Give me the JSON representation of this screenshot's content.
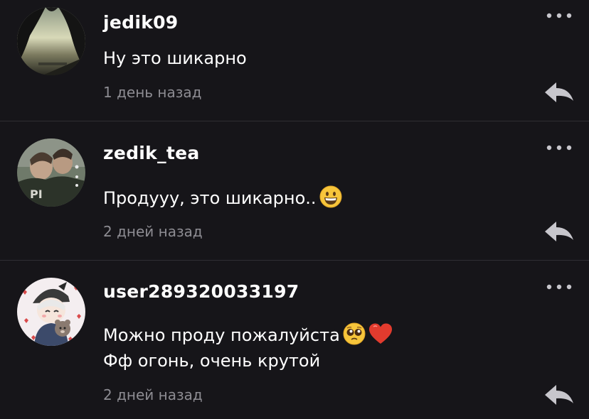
{
  "comments": [
    {
      "username": "jedik09",
      "text_lines": [
        "Ну это шикарно"
      ],
      "time": "1 день назад",
      "avatar": "photo-silhouette-sunset",
      "more_icon": "more-dots-icon",
      "reply_icon": "reply-arrow-icon"
    },
    {
      "username": "zedik_tea",
      "text_lines": [
        "Продууу, это шикарно.."
      ],
      "emojis": [
        "grinning-face-emoji"
      ],
      "time": "2 дней назад",
      "avatar": "photo-two-people",
      "more_icon": "more-dots-icon",
      "reply_icon": "reply-arrow-icon"
    },
    {
      "username": "user289320033197",
      "text_lines": [
        "Можно проду пожалуйста",
        "Фф огонь, очень крутой"
      ],
      "emojis": [
        "pleading-face-emoji",
        "red-heart-emoji"
      ],
      "time": "2 дней назад",
      "avatar": "anime-character-with-bear",
      "more_icon": "more-dots-icon",
      "reply_icon": "reply-arrow-icon"
    }
  ],
  "colors": {
    "background": "#161519",
    "divider": "#2f2e33",
    "text": "#ffffff",
    "timestamp": "#8d8c92",
    "icon": "#c7c6cc"
  }
}
